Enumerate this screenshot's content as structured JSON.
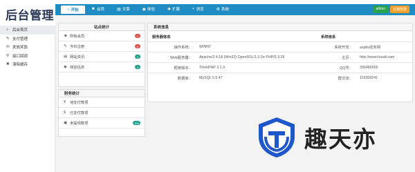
{
  "app": {
    "logo": "后台管理"
  },
  "nav": {
    "tabs": [
      {
        "label": "开始",
        "icon": "home-icon",
        "glyph": "⌂",
        "active": true
      },
      {
        "label": "会员",
        "icon": "user-icon",
        "glyph": "☻"
      },
      {
        "label": "文章",
        "icon": "file-icon",
        "glyph": "▤"
      },
      {
        "label": "体验",
        "icon": "task-icon",
        "glyph": "◉"
      },
      {
        "label": "扩展",
        "icon": "plugin-icon",
        "glyph": "✚"
      },
      {
        "label": "浏览",
        "icon": "eye-icon",
        "glyph": "◐"
      },
      {
        "label": "系统",
        "icon": "gear-icon",
        "glyph": "⚙"
      }
    ],
    "admin_label": "admin",
    "logout_label": "注销登录"
  },
  "sidebar": {
    "items": [
      {
        "label": "后台首页",
        "icon": "home-icon",
        "glyph": "⌂",
        "active": true
      },
      {
        "label": "支付管理",
        "icon": "pay-icon",
        "glyph": "✎"
      },
      {
        "label": "发放奖励",
        "icon": "reward-icon",
        "glyph": "✉"
      },
      {
        "label": "接口回调",
        "icon": "link-icon",
        "glyph": "⚲"
      },
      {
        "label": "清除缓存",
        "icon": "clear-icon",
        "glyph": "✖"
      }
    ]
  },
  "site_stats": {
    "title": "站点统计",
    "rows": [
      {
        "label": "所有会员",
        "icon": "user-icon",
        "glyph": "☻",
        "badge": "1",
        "color": "red"
      },
      {
        "label": "今日注册",
        "icon": "edit-icon",
        "glyph": "✎",
        "badge": "0",
        "color": "red"
      },
      {
        "label": "网站资讯",
        "icon": "news-icon",
        "glyph": "▤",
        "badge": "3",
        "color": "green"
      },
      {
        "label": "体验任务",
        "icon": "task-icon",
        "glyph": "◉",
        "badge": "0",
        "color": "green"
      }
    ]
  },
  "finance": {
    "title": "财务统计",
    "rows": [
      {
        "label": "待支付款项",
        "icon": "yen-icon",
        "glyph": "¥",
        "badge": ""
      },
      {
        "label": "已支付款项",
        "icon": "dollar-icon",
        "glyph": "$",
        "badge": ""
      },
      {
        "label": "未提现款项",
        "icon": "wallet-icon",
        "glyph": "▣",
        "badge": "200",
        "color": "green"
      }
    ]
  },
  "system": {
    "title": "系统信息",
    "head_left": "服务器信息",
    "head_right": "系统信息",
    "rows": [
      {
        "k1": "操作系统：",
        "v1": "WINNT",
        "k2": "系统开发：",
        "v2": "aspku任务网"
      },
      {
        "k1": "Web服务器：",
        "v1": "Apache/2.4.18 (Win32) OpenSSL/1.0.2e PHP/5.3.29",
        "k2": "主页：",
        "v2": "http://www.huudi.com"
      },
      {
        "k1": "框架版本：",
        "v1": "ThinkPHP 3.1.3",
        "k2": "QQ号：",
        "v2": "395486566"
      },
      {
        "k1": "数据库：",
        "v1": "MySQL 5.5.47",
        "k2": "群交流：",
        "v2": "119368241"
      }
    ]
  },
  "watermark": {
    "text": "趣天亦",
    "icon": "shield-logo-icon"
  },
  "colors": {
    "primary": "#1f8dc4",
    "admin": "#2ba24c",
    "logout": "#f0a028",
    "badge_red": "#d9534f",
    "badge_green": "#1e9e8a"
  }
}
